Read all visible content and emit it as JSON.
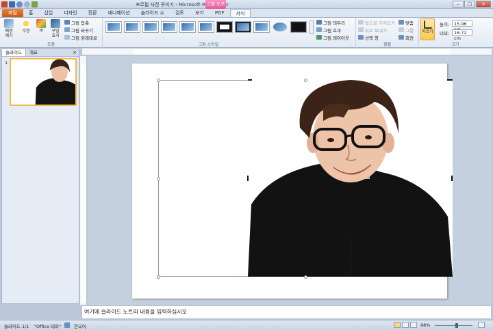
{
  "titlebar": {
    "title": "프로필 사진 꾸미기 - Microsoft PowerPoint",
    "context": "그림 도구"
  },
  "tabs": [
    "파일",
    "홈",
    "삽입",
    "디자인",
    "전환",
    "애니메이션",
    "슬라이드 쇼",
    "검토",
    "보기",
    "PDF",
    "서식"
  ],
  "ribbon": {
    "adjust": {
      "remove_bg": "배경\n제거",
      "correct": "수정",
      "color": "색",
      "effects": "꾸밈\n효과",
      "compress": "그림 압축",
      "change": "그림 바꾸기",
      "reset": "그림 원래대로",
      "label": "조정"
    },
    "styles": {
      "label": "그림 스타일",
      "border": "그림 테두리",
      "effects": "그림 효과",
      "layout": "그림 레이아웃"
    },
    "arrange": {
      "label": "정렬",
      "forward": "앞으로 가져오기",
      "backward": "뒤로 보내기",
      "pane": "선택 창",
      "align": "맞춤",
      "group": "그룹",
      "rotate": "회전"
    },
    "size": {
      "label": "크기",
      "crop": "자르기",
      "height_label": "높이:",
      "height": "15.96 cm",
      "width_label": "너비:",
      "width": "16.72 cm"
    }
  },
  "panel": {
    "tab_slides": "슬라이드",
    "tab_outline": "개요",
    "close": "×",
    "slide_number": "1"
  },
  "notes": {
    "text": "여기에 슬라이드 노트의 내용을 입력하십시오"
  },
  "status": {
    "slide": "슬라이드 1/1",
    "theme": "\"Office 테마\"",
    "lang": "한국어",
    "zoom": "98%"
  },
  "colors": {
    "accent": "#e85a9a",
    "file_tab": "#c95a14"
  }
}
